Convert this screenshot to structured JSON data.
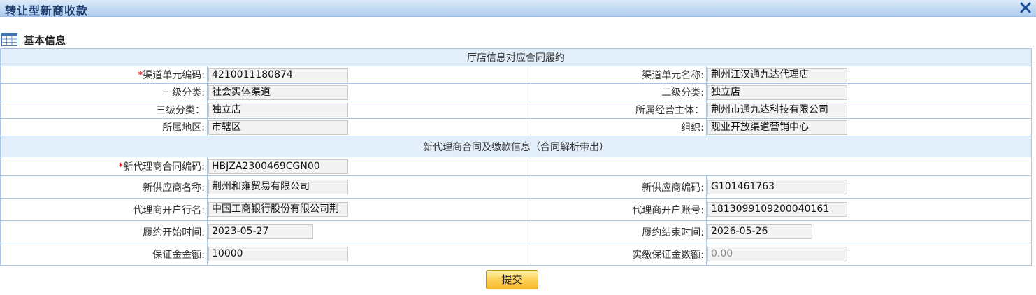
{
  "window": {
    "title": "转让型新商收款"
  },
  "section": {
    "title": "基本信息"
  },
  "group1": {
    "title": "厅店信息对应合同履约"
  },
  "group2": {
    "title": "新代理商合同及缴款信息（合同解析带出）"
  },
  "fields": {
    "channel_code": {
      "label": "渠道单元编码:",
      "value": "4210011180874",
      "required": true
    },
    "channel_name": {
      "label": "渠道单元名称:",
      "value": "荆州江汉通九达代理店"
    },
    "level1": {
      "label": "一级分类:",
      "value": "社会实体渠道"
    },
    "level2": {
      "label": "二级分类:",
      "value": "独立店"
    },
    "level3": {
      "label": "三级分类：",
      "value": "独立店"
    },
    "entity": {
      "label": "所属经营主体：",
      "value": "荆州市通九达科技有限公司"
    },
    "region": {
      "label": "所属地区:",
      "value": "市辖区"
    },
    "org": {
      "label": "组织:",
      "value": "现业开放渠道营销中心"
    },
    "contract_code": {
      "label": "新代理商合同编码:",
      "value": "HBJZA2300469CGN00",
      "required": true
    },
    "supplier_name": {
      "label": "新供应商名称:",
      "value": "荆州和雍贸易有限公司"
    },
    "supplier_code": {
      "label": "新供应商编码:",
      "value": "G101461763"
    },
    "bank": {
      "label": "代理商开户行名:",
      "value": "中国工商银行股份有限公司荆"
    },
    "account": {
      "label": "代理商开户账号:",
      "value": "1813099109200040161"
    },
    "start_date": {
      "label": "履约开始时间:",
      "value": "2023-05-27"
    },
    "end_date": {
      "label": "履约结束时间:",
      "value": "2026-05-26"
    },
    "deposit": {
      "label": "保证金金额:",
      "value": "10000"
    },
    "paid_deposit": {
      "label": "实缴保证金数额:",
      "value": "0.00"
    }
  },
  "required_mark": "*",
  "buttons": {
    "submit": "提交"
  },
  "icons": {
    "close": "close-icon",
    "section": "table-icon"
  },
  "colors": {
    "titlebar": "#c2d9f2",
    "subheader": "#e3eefb",
    "border": "#a7c4e4",
    "required": "#d40000",
    "button": "#fcd45c"
  }
}
